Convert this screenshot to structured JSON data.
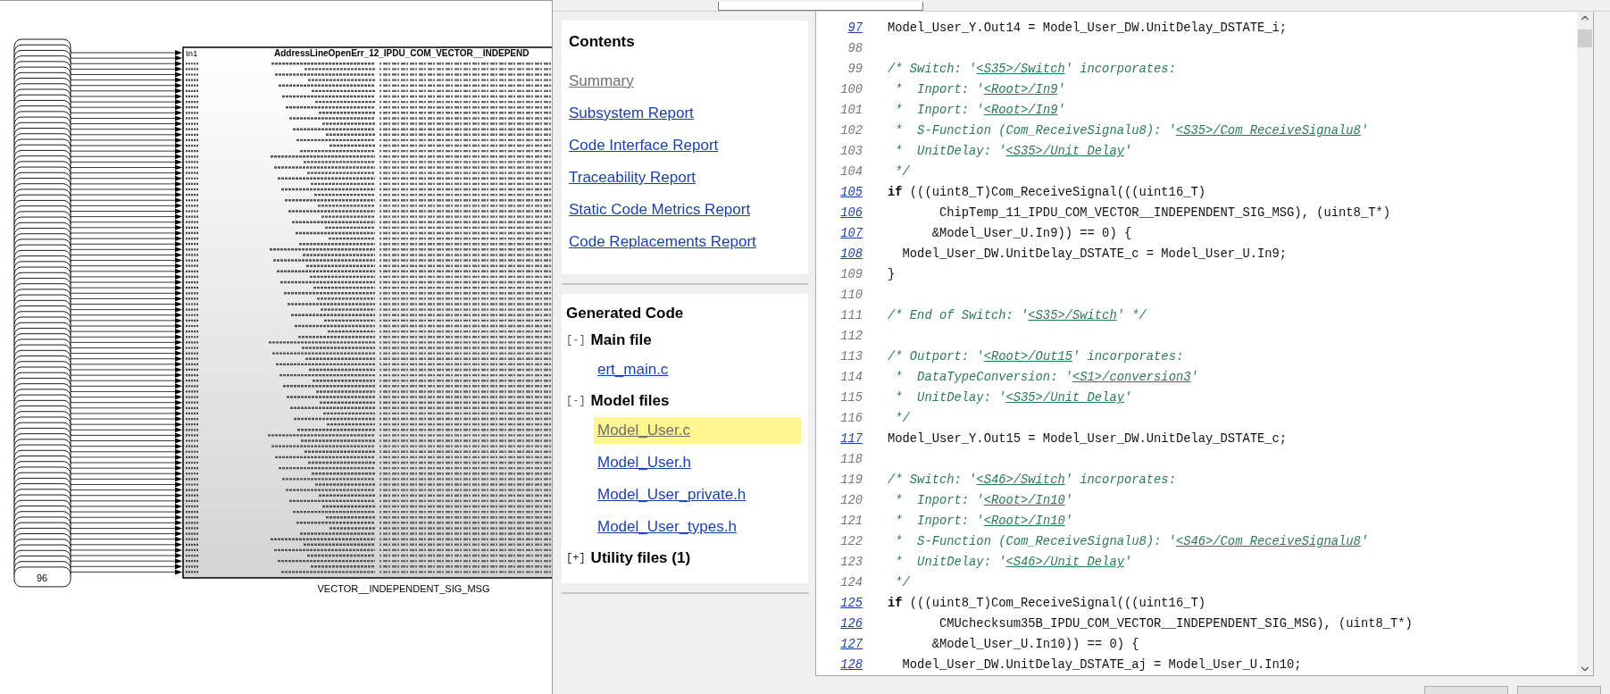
{
  "diagram": {
    "last_inport_label": "96",
    "first_port": {
      "label": "In1",
      "signal": "AddressLineOpenErr_12_IPDU_COM_VECTOR__INDEPEND"
    },
    "block_name": "VECTOR__INDEPENDENT_SIG_MSG"
  },
  "contents": {
    "title": "Contents",
    "links": [
      {
        "label": "Summary",
        "visited": true
      },
      {
        "label": "Subsystem Report",
        "visited": false
      },
      {
        "label": "Code Interface Report",
        "visited": false
      },
      {
        "label": "Traceability Report",
        "visited": false
      },
      {
        "label": "Static Code Metrics Report",
        "visited": false
      },
      {
        "label": "Code Replacements Report",
        "visited": false
      }
    ]
  },
  "generated_code": {
    "title": "Generated Code",
    "groups": [
      {
        "toggle": "[-]",
        "label": "Main file",
        "expanded": true,
        "files": [
          {
            "label": "ert_main.c",
            "selected": false
          }
        ]
      },
      {
        "toggle": "[-]",
        "label": "Model files",
        "expanded": true,
        "files": [
          {
            "label": "Model_User.c",
            "selected": true
          },
          {
            "label": "Model_User.h",
            "selected": false
          },
          {
            "label": "Model_User_private.h",
            "selected": false
          },
          {
            "label": "Model_User_types.h",
            "selected": false
          }
        ]
      },
      {
        "toggle": "[+]",
        "label": "Utility files (1)",
        "expanded": false
      }
    ]
  },
  "code": {
    "lines": [
      {
        "number": "97",
        "linked": true,
        "segments": [
          {
            "kind": "code",
            "text": "Model_User_Y.Out14 = Model_User_DW.UnitDelay_DSTATE_i;"
          }
        ]
      },
      {
        "number": "98",
        "linked": false
      },
      {
        "number": "99",
        "linked": false,
        "segments": [
          {
            "kind": "comment",
            "text": "/* Switch: '"
          },
          {
            "kind": "link",
            "text": "<S35>/Switch"
          },
          {
            "kind": "comment",
            "text": "' incorporates:"
          }
        ]
      },
      {
        "number": "100",
        "linked": false,
        "segments": [
          {
            "kind": "comment",
            "text": " *  Inport: '"
          },
          {
            "kind": "link",
            "text": "<Root>/In9"
          },
          {
            "kind": "comment",
            "text": "'"
          }
        ]
      },
      {
        "number": "101",
        "linked": false,
        "segments": [
          {
            "kind": "comment",
            "text": " *  Inport: '"
          },
          {
            "kind": "link",
            "text": "<Root>/In9"
          },
          {
            "kind": "comment",
            "text": "'"
          }
        ]
      },
      {
        "number": "102",
        "linked": false,
        "segments": [
          {
            "kind": "comment",
            "text": " *  S-Function (Com_ReceiveSignalu8): '"
          },
          {
            "kind": "link",
            "text": "<S35>/Com_ReceiveSignalu8"
          },
          {
            "kind": "comment",
            "text": "'"
          }
        ]
      },
      {
        "number": "103",
        "linked": false,
        "segments": [
          {
            "kind": "comment",
            "text": " *  UnitDelay: '"
          },
          {
            "kind": "link",
            "text": "<S35>/Unit Delay"
          },
          {
            "kind": "comment",
            "text": "'"
          }
        ]
      },
      {
        "number": "104",
        "linked": false,
        "segments": [
          {
            "kind": "comment",
            "text": " */"
          }
        ]
      },
      {
        "number": "105",
        "linked": true,
        "segments": [
          {
            "kind": "keyword",
            "text": "if"
          },
          {
            "kind": "code",
            "text": " (((uint8_T)Com_ReceiveSignal(((uint16_T)"
          }
        ]
      },
      {
        "number": "106",
        "linked": true,
        "segments": [
          {
            "kind": "code",
            "text": "       ChipTemp_11_IPDU_COM_VECTOR__INDEPENDENT_SIG_MSG), (uint8_T*)"
          }
        ]
      },
      {
        "number": "107",
        "linked": true,
        "segments": [
          {
            "kind": "code",
            "text": "      &Model_User_U.In9)) == 0) {"
          }
        ]
      },
      {
        "number": "108",
        "linked": true,
        "segments": [
          {
            "kind": "code",
            "text": "  Model_User_DW.UnitDelay_DSTATE_c = Model_User_U.In9;"
          }
        ]
      },
      {
        "number": "109",
        "linked": false,
        "segments": [
          {
            "kind": "code",
            "text": "}"
          }
        ]
      },
      {
        "number": "110",
        "linked": false
      },
      {
        "number": "111",
        "linked": false,
        "segments": [
          {
            "kind": "comment",
            "text": "/* End of Switch: '"
          },
          {
            "kind": "link",
            "text": "<S35>/Switch"
          },
          {
            "kind": "comment",
            "text": "' */"
          }
        ]
      },
      {
        "number": "112",
        "linked": false
      },
      {
        "number": "113",
        "linked": false,
        "segments": [
          {
            "kind": "comment",
            "text": "/* Outport: '"
          },
          {
            "kind": "link",
            "text": "<Root>/Out15"
          },
          {
            "kind": "comment",
            "text": "' incorporates:"
          }
        ]
      },
      {
        "number": "114",
        "linked": false,
        "segments": [
          {
            "kind": "comment",
            "text": " *  DataTypeConversion: '"
          },
          {
            "kind": "link",
            "text": "<S1>/conversion3"
          },
          {
            "kind": "comment",
            "text": "'"
          }
        ]
      },
      {
        "number": "115",
        "linked": false,
        "segments": [
          {
            "kind": "comment",
            "text": " *  UnitDelay: '"
          },
          {
            "kind": "link",
            "text": "<S35>/Unit Delay"
          },
          {
            "kind": "comment",
            "text": "'"
          }
        ]
      },
      {
        "number": "116",
        "linked": false,
        "segments": [
          {
            "kind": "comment",
            "text": " */"
          }
        ]
      },
      {
        "number": "117",
        "linked": true,
        "segments": [
          {
            "kind": "code",
            "text": "Model_User_Y.Out15 = Model_User_DW.UnitDelay_DSTATE_c;"
          }
        ]
      },
      {
        "number": "118",
        "linked": false
      },
      {
        "number": "119",
        "linked": false,
        "segments": [
          {
            "kind": "comment",
            "text": "/* Switch: '"
          },
          {
            "kind": "link",
            "text": "<S46>/Switch"
          },
          {
            "kind": "comment",
            "text": "' incorporates:"
          }
        ]
      },
      {
        "number": "120",
        "linked": false,
        "segments": [
          {
            "kind": "comment",
            "text": " *  Inport: '"
          },
          {
            "kind": "link",
            "text": "<Root>/In10"
          },
          {
            "kind": "comment",
            "text": "'"
          }
        ]
      },
      {
        "number": "121",
        "linked": false,
        "segments": [
          {
            "kind": "comment",
            "text": " *  Inport: '"
          },
          {
            "kind": "link",
            "text": "<Root>/In10"
          },
          {
            "kind": "comment",
            "text": "'"
          }
        ]
      },
      {
        "number": "122",
        "linked": false,
        "segments": [
          {
            "kind": "comment",
            "text": " *  S-Function (Com_ReceiveSignalu8): '"
          },
          {
            "kind": "link",
            "text": "<S46>/Com_ReceiveSignalu8"
          },
          {
            "kind": "comment",
            "text": "'"
          }
        ]
      },
      {
        "number": "123",
        "linked": false,
        "segments": [
          {
            "kind": "comment",
            "text": " *  UnitDelay: '"
          },
          {
            "kind": "link",
            "text": "<S46>/Unit Delay"
          },
          {
            "kind": "comment",
            "text": "'"
          }
        ]
      },
      {
        "number": "124",
        "linked": false,
        "segments": [
          {
            "kind": "comment",
            "text": " */"
          }
        ]
      },
      {
        "number": "125",
        "linked": true,
        "segments": [
          {
            "kind": "keyword",
            "text": "if"
          },
          {
            "kind": "code",
            "text": " (((uint8_T)Com_ReceiveSignal(((uint16_T)"
          }
        ]
      },
      {
        "number": "126",
        "linked": true,
        "segments": [
          {
            "kind": "code",
            "text": "       CMUchecksum35B_IPDU_COM_VECTOR__INDEPENDENT_SIG_MSG), (uint8_T*)"
          }
        ]
      },
      {
        "number": "127",
        "linked": true,
        "segments": [
          {
            "kind": "code",
            "text": "      &Model_User_U.In10)) == 0) {"
          }
        ]
      },
      {
        "number": "128",
        "linked": true,
        "segments": [
          {
            "kind": "code",
            "text": "  Model_User_DW.UnitDelay_DSTATE_aj = Model_User_U.In10;"
          }
        ]
      }
    ]
  }
}
